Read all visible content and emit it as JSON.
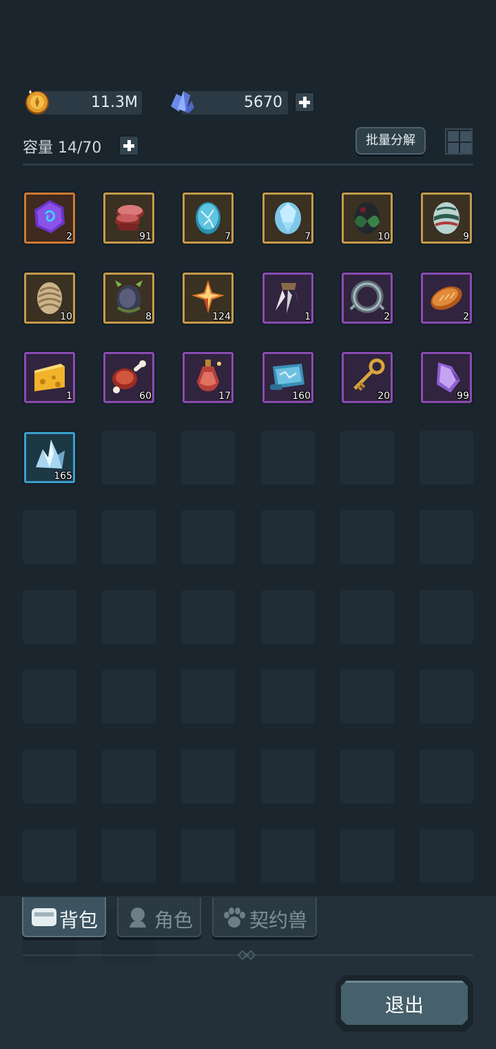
{
  "currency": {
    "gold": {
      "value": "11.3M",
      "icon": "gold-coin-icon"
    },
    "gems": {
      "value": "5670",
      "icon": "crystal-icon"
    }
  },
  "inventory": {
    "capacity_label": "容量 14/70",
    "decompose_label": "批量分解",
    "total_slots": 56,
    "items": [
      {
        "icon": "purple-rune-stone-icon",
        "count": "2",
        "rarity": "orange"
      },
      {
        "icon": "raw-meat-icon",
        "count": "91",
        "rarity": "gold"
      },
      {
        "icon": "blue-egg-icon",
        "count": "7",
        "rarity": "gold"
      },
      {
        "icon": "ice-egg-icon",
        "count": "7",
        "rarity": "gold"
      },
      {
        "icon": "dark-leaf-egg-icon",
        "count": "10",
        "rarity": "gold"
      },
      {
        "icon": "green-striped-egg-icon",
        "count": "9",
        "rarity": "gold"
      },
      {
        "icon": "scaled-egg-icon",
        "count": "10",
        "rarity": "gold"
      },
      {
        "icon": "horned-dark-egg-icon",
        "count": "8",
        "rarity": "gold"
      },
      {
        "icon": "orange-crystal-icon",
        "count": "124",
        "rarity": "gold"
      },
      {
        "icon": "claw-icon",
        "count": "1",
        "rarity": "purple"
      },
      {
        "icon": "collar-ring-icon",
        "count": "2",
        "rarity": "purple"
      },
      {
        "icon": "bread-icon",
        "count": "2",
        "rarity": "purple"
      },
      {
        "icon": "cheese-icon",
        "count": "1",
        "rarity": "purple"
      },
      {
        "icon": "meat-bone-icon",
        "count": "60",
        "rarity": "purple"
      },
      {
        "icon": "potion-icon",
        "count": "17",
        "rarity": "purple"
      },
      {
        "icon": "map-scroll-icon",
        "count": "160",
        "rarity": "purple"
      },
      {
        "icon": "golden-key-icon",
        "count": "20",
        "rarity": "purple"
      },
      {
        "icon": "purple-shard-icon",
        "count": "99",
        "rarity": "purple"
      },
      {
        "icon": "ice-crystal-icon",
        "count": "165",
        "rarity": "blue"
      }
    ]
  },
  "tabs": [
    {
      "label": "背包",
      "icon": "backpack-icon",
      "active": true
    },
    {
      "label": "角色",
      "icon": "character-icon",
      "active": false
    },
    {
      "label": "契约兽",
      "icon": "paw-icon",
      "active": false
    }
  ],
  "exit_label": "退出"
}
